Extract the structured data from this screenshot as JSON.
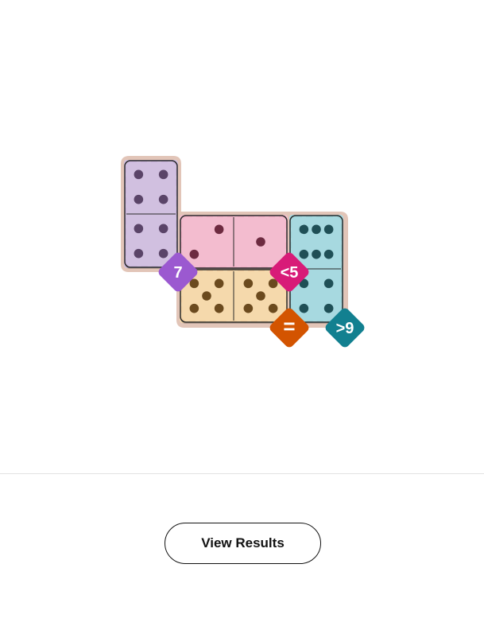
{
  "game": {
    "name_icon": "domino-puzzle",
    "colors": {
      "tray": "#e2c5b8",
      "domino_face": "#ffffff",
      "domino_border": "#2a2a2a",
      "purple_region": "#d4c2e3",
      "purple_accent": "#8a4ac8",
      "purple_badge": "#9b59d0",
      "pink_region": "#f6bfd1",
      "pink_accent": "#e0195e",
      "pink_badge": "#d81b78",
      "orange_region": "#f9dcaf",
      "orange_accent": "#d35400",
      "orange_badge": "#d35400",
      "teal_region": "#a9dce3",
      "teal_accent": "#1d7d86",
      "teal_badge": "#128090",
      "pip_dark": "#4a3b55"
    },
    "dominoes": [
      {
        "id": "domino-vertical-left",
        "orientation": "vertical",
        "halves": [
          4,
          4
        ],
        "region": "purple"
      },
      {
        "id": "domino-pink-pair",
        "orientation": "horizontal",
        "halves": [
          2,
          1
        ],
        "region": "pink"
      },
      {
        "id": "domino-teal-vertical",
        "orientation": "vertical",
        "halves": [
          6,
          4
        ],
        "region": "teal"
      },
      {
        "id": "domino-orange-pair",
        "orientation": "horizontal",
        "halves": [
          5,
          5
        ],
        "region": "orange"
      }
    ],
    "constraints": [
      {
        "name": "purple-sum-badge",
        "label": "7",
        "color": "purple"
      },
      {
        "name": "pink-less-than-badge",
        "label": "<5",
        "color": "pink"
      },
      {
        "name": "orange-equal-badge",
        "label": "=",
        "color": "orange"
      },
      {
        "name": "teal-greater-than-badge",
        "label": ">9",
        "color": "teal"
      }
    ]
  },
  "actions": {
    "view_results_label": "View Results"
  }
}
